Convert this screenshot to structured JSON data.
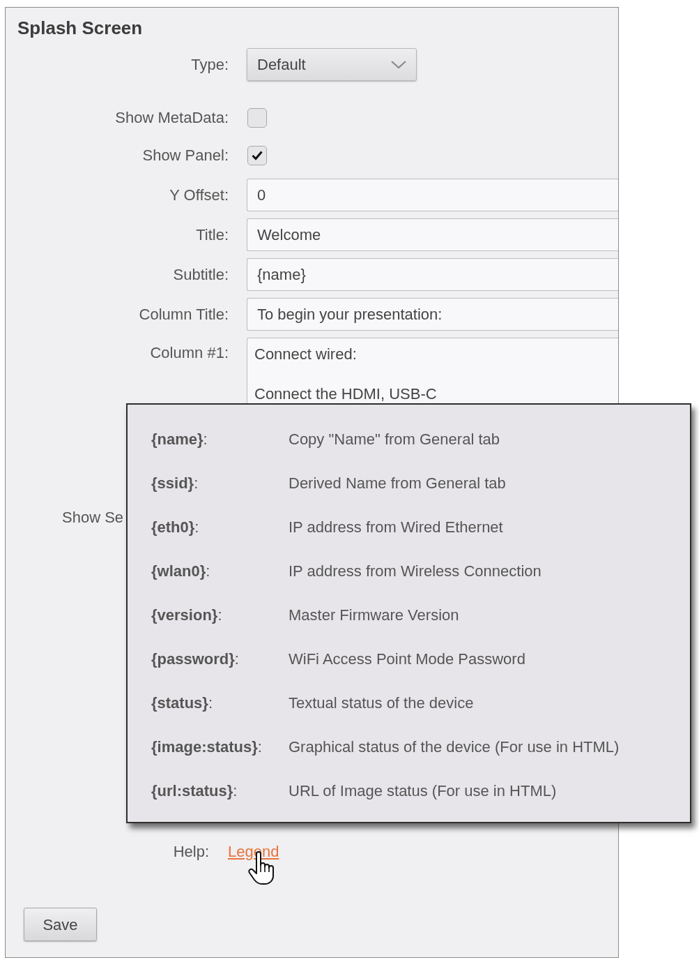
{
  "section": {
    "title": "Splash Screen"
  },
  "fields": [
    {
      "kind": "select",
      "label": "Type:",
      "value": "Default"
    },
    {
      "kind": "checkbox",
      "label": "Show MetaData:",
      "checked": false
    },
    {
      "kind": "checkbox",
      "label": "Show Panel:",
      "checked": true
    },
    {
      "kind": "text",
      "label": "Y Offset:",
      "value": "0"
    },
    {
      "kind": "text",
      "label": "Title:",
      "value": "Welcome"
    },
    {
      "kind": "text",
      "label": "Subtitle:",
      "value": "{name}"
    },
    {
      "kind": "text",
      "label": "Column Title:",
      "value": "To begin your presentation:"
    },
    {
      "kind": "textarea",
      "label": "Column #1:",
      "paragraphs": [
        "Connect wired:",
        "Connect the HDMI, USB-C"
      ]
    },
    {
      "kind": "label_only",
      "label": "Show Se"
    }
  ],
  "help": {
    "label": "Help:",
    "link": "Legend"
  },
  "legend_popup": {
    "rows": [
      {
        "token": "**{name}**:",
        "description": "Copy \"Name\" from General tab"
      },
      {
        "token": "**{ssid}**:",
        "description": "Derived Name from General tab"
      },
      {
        "token": "**{eth0}**:",
        "description": "IP address from Wired Ethernet"
      },
      {
        "token": "**{wlan0}**:",
        "description": "IP address from Wireless Connection"
      },
      {
        "token": "**{version}**:",
        "description": "Master Firmware Version"
      },
      {
        "token": "**{password}**:",
        "description": "WiFi Access Point Mode Password"
      },
      {
        "token": "**{status}**:",
        "description": "Textual status of the device"
      },
      {
        "token": "**{image:status}**:",
        "description": "Graphical status of the device (For use in HTML)"
      },
      {
        "token": "**{url:status}**:",
        "description": "URL of Image status (For use in HTML)"
      }
    ]
  },
  "save_button": "Save"
}
